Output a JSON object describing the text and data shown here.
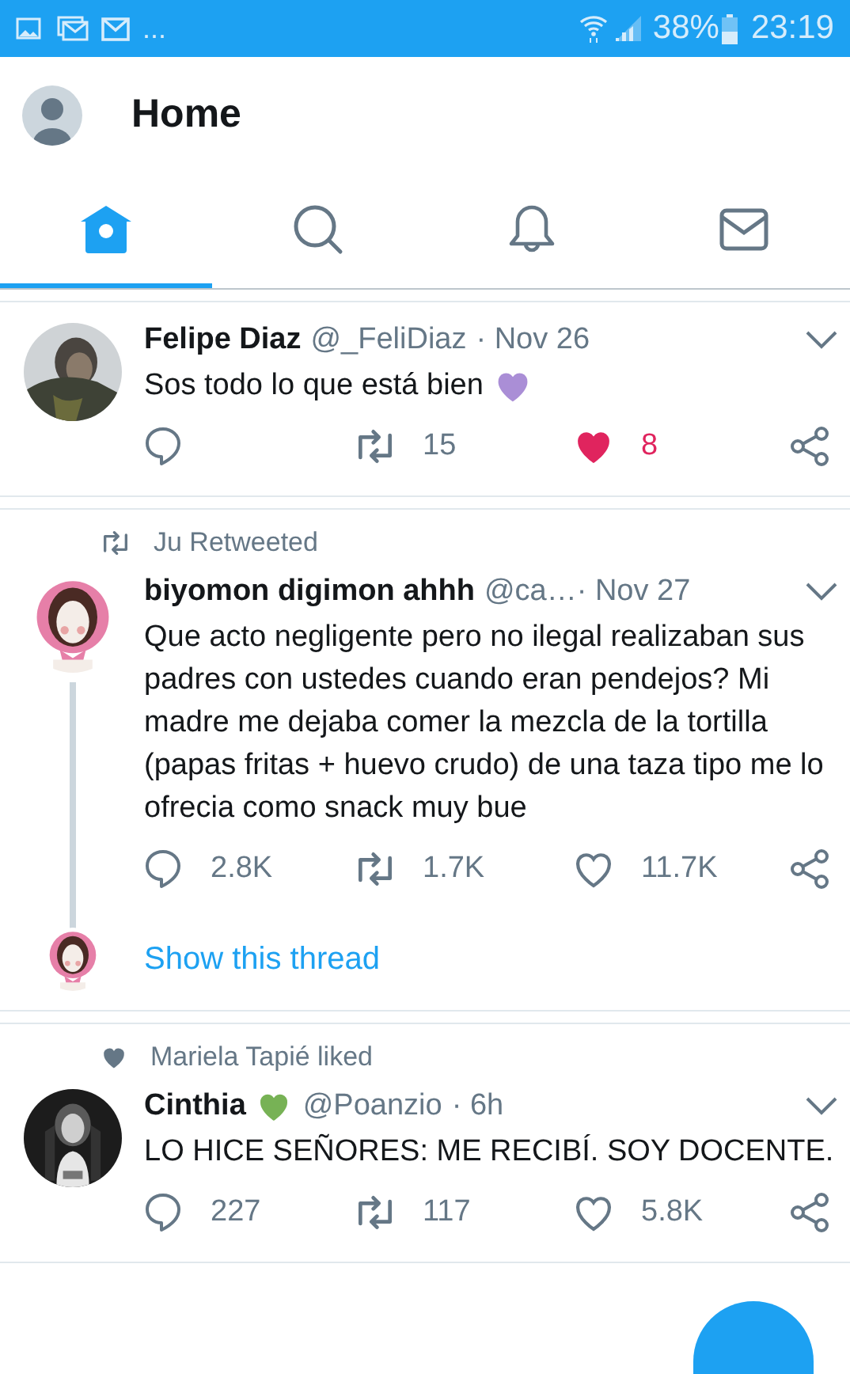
{
  "status_bar": {
    "overflow": "...",
    "battery": "38%",
    "time": "23:19"
  },
  "header": {
    "title": "Home"
  },
  "tabs": [
    {
      "kind": "home",
      "selected": true
    },
    {
      "kind": "search",
      "selected": false
    },
    {
      "kind": "notifications",
      "selected": false
    },
    {
      "kind": "messages",
      "selected": false
    }
  ],
  "tweets": [
    {
      "name": "Felipe Diaz",
      "handle": "@_FeliDiaz",
      "time": "· Nov 26",
      "body": "Sos todo lo que está bien",
      "body_emoji": {
        "color": "#aa8ed6"
      },
      "actions": {
        "retweets": "15",
        "likes": "8",
        "liked": true
      }
    },
    {
      "context": {
        "kind": "retweet",
        "text": "Ju Retweeted"
      },
      "name": "biyomon digimon ahhh",
      "handle": "@ca…",
      "time": "· Nov 27",
      "body": "Que acto negligente pero no ilegal realizaban sus padres con ustedes cuando eran pendejos? Mi madre me dejaba comer la mezcla de la tortilla (papas fritas + huevo crudo) de una taza tipo me lo ofrecia como snack muy bue",
      "actions": {
        "replies": "2.8K",
        "retweets": "1.7K",
        "likes": "11.7K",
        "liked": false
      },
      "thread_link": "Show this thread"
    },
    {
      "context": {
        "kind": "like",
        "text": "Mariela Tapié liked"
      },
      "name": "Cinthia",
      "name_emoji": {
        "color": "#77b255"
      },
      "handle": "@Poanzio",
      "time": "· 6h",
      "body": "LO HICE SEÑORES: ME RECIBÍ. SOY DOCENTE.",
      "actions": {
        "replies": "227",
        "retweets": "117",
        "likes": "5.8K",
        "liked": false
      }
    }
  ]
}
